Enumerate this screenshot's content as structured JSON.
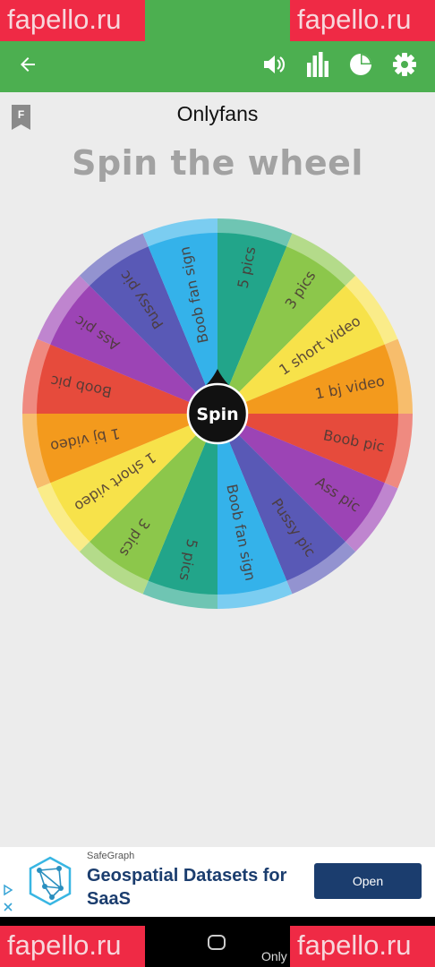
{
  "watermark": {
    "top_left": "fapello.ru",
    "top_right": "fapello.ru",
    "bottom_left": "fapello.ru",
    "bottom_right": "fapello.ru"
  },
  "toolbar": {
    "back_icon": "arrow-left-icon",
    "sound_icon": "volume-icon",
    "stats_icon": "bar-chart-icon",
    "pie_icon": "pie-chart-icon",
    "settings_icon": "gear-icon"
  },
  "wheel": {
    "title": "Onlyfans",
    "headline": "Spin the wheel",
    "bookmark_letter": "F",
    "spin_label": "Spin",
    "segments": [
      {
        "label": "5 pics",
        "color": "#22a58a"
      },
      {
        "label": "3 pics",
        "color": "#8cc74b"
      },
      {
        "label": "1 short video",
        "color": "#f7e24a"
      },
      {
        "label": "1 bj video",
        "color": "#f39a1d"
      },
      {
        "label": "Boob pic",
        "color": "#e64b3c"
      },
      {
        "label": "Ass pic",
        "color": "#9c44b5"
      },
      {
        "label": "Pussy pic",
        "color": "#5959b6"
      },
      {
        "label": "Boob fan sign",
        "color": "#34b2ea"
      },
      {
        "label": "5 pics",
        "color": "#22a58a"
      },
      {
        "label": "3 pics",
        "color": "#8cc74b"
      },
      {
        "label": "1 short video",
        "color": "#f7e24a"
      },
      {
        "label": "1 bj video",
        "color": "#f39a1d"
      },
      {
        "label": "Boob pic",
        "color": "#e64b3c"
      },
      {
        "label": "Ass pic",
        "color": "#9c44b5"
      },
      {
        "label": "Pussy pic",
        "color": "#5959b6"
      },
      {
        "label": "Boob fan sign",
        "color": "#34b2ea"
      }
    ]
  },
  "ad": {
    "advertiser": "SafeGraph",
    "headline": "Geospatial Datasets for SaaS",
    "button": "Open"
  },
  "navbar": {
    "label": "Only"
  }
}
